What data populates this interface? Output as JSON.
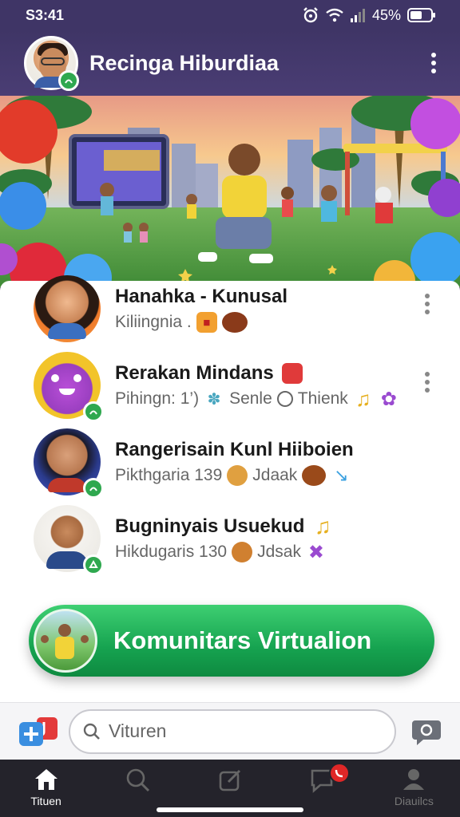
{
  "status_bar": {
    "time": "S3:41",
    "battery": "45%"
  },
  "header": {
    "title": "Recinga Hiburdiaa"
  },
  "chats": [
    {
      "name": "Hanahka - Kunusal",
      "subtitle": "Kiliingnia .",
      "icons": [
        "juice-box-emoji",
        "football-emoji"
      ]
    },
    {
      "name": "Rerakan Mindans",
      "subtitle_a": "Pihingn: 1’)",
      "subtitle_b": "Senle",
      "subtitle_c": "Thienk",
      "icons": [
        "dancer-emoji",
        "music-note-emoji",
        "flower-emoji",
        "red-cup-emoji"
      ]
    },
    {
      "name": "Rangerisain Kunl Hiiboien",
      "subtitle_a": "Pikthgaria 139",
      "subtitle_b": "Jdaak",
      "icons": [
        "cookie-emoji",
        "football-emoji",
        "arrow-emoji"
      ]
    },
    {
      "name": "Bugninyais Usuekud",
      "subtitle_a": "Hikdugaris 130",
      "subtitle_b": "Jdsak",
      "icons": [
        "music-note-emoji",
        "cookie-emoji",
        "flower-emoji"
      ]
    }
  ],
  "cta": {
    "label": "Komunitars Virtualion"
  },
  "search": {
    "placeholder": "Vituren"
  },
  "bottom_nav": {
    "items": [
      {
        "label": "Tituen",
        "icon": "home-icon",
        "active": true
      },
      {
        "label": "",
        "icon": "search-icon",
        "active": false
      },
      {
        "label": "",
        "icon": "edit-icon",
        "active": false
      },
      {
        "label": "",
        "icon": "chat-icon",
        "active": false,
        "badge": true
      },
      {
        "label": "Diauilcs",
        "icon": "profile-icon",
        "active": false
      }
    ]
  },
  "colors": {
    "header_bg": "#3f3566",
    "cta_green": "#16a350",
    "online_green": "#2fa84f",
    "badge_red": "#e02727",
    "nav_bg": "#24232b"
  }
}
